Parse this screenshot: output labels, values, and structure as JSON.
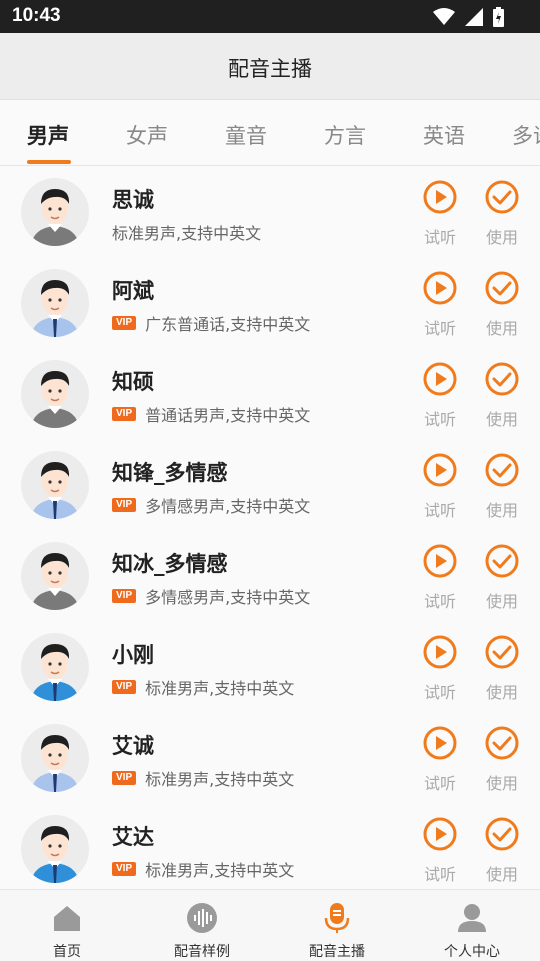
{
  "status_bar": {
    "time": "10:43"
  },
  "header": {
    "title": "配音主播"
  },
  "tabs": [
    {
      "label": "男声",
      "active": true
    },
    {
      "label": "女声",
      "active": false
    },
    {
      "label": "童音",
      "active": false
    },
    {
      "label": "方言",
      "active": false
    },
    {
      "label": "英语",
      "active": false
    },
    {
      "label": "多语",
      "active": false
    }
  ],
  "actions": {
    "play_label": "试听",
    "use_label": "使用"
  },
  "vip_badge": "VIP",
  "voices": [
    {
      "name": "思诚",
      "desc": "标准男声,支持中英文",
      "vip": false,
      "shirt": "gray"
    },
    {
      "name": "阿斌",
      "desc": "广东普通话,支持中英文",
      "vip": true,
      "shirt": "blue"
    },
    {
      "name": "知硕",
      "desc": "普通话男声,支持中英文",
      "vip": true,
      "shirt": "gray"
    },
    {
      "name": "知锋_多情感",
      "desc": "多情感男声,支持中英文",
      "vip": true,
      "shirt": "blue"
    },
    {
      "name": "知冰_多情感",
      "desc": "多情感男声,支持中英文",
      "vip": true,
      "shirt": "gray"
    },
    {
      "name": "小刚",
      "desc": "标准男声,支持中英文",
      "vip": true,
      "shirt": "cyan"
    },
    {
      "name": "艾诚",
      "desc": "标准男声,支持中英文",
      "vip": true,
      "shirt": "blue"
    },
    {
      "name": "艾达",
      "desc": "标准男声,支持中英文",
      "vip": true,
      "shirt": "cyan"
    }
  ],
  "bottom_nav": [
    {
      "label": "首页",
      "icon": "home-icon",
      "active": false
    },
    {
      "label": "配音样例",
      "icon": "soundwave-icon",
      "active": false
    },
    {
      "label": "配音主播",
      "icon": "microphone-icon",
      "active": true
    },
    {
      "label": "个人中心",
      "icon": "person-icon",
      "active": false
    }
  ],
  "colors": {
    "accent": "#f07b1d",
    "vip": "#f06a1d",
    "nav_inactive": "#9a9a9a"
  }
}
